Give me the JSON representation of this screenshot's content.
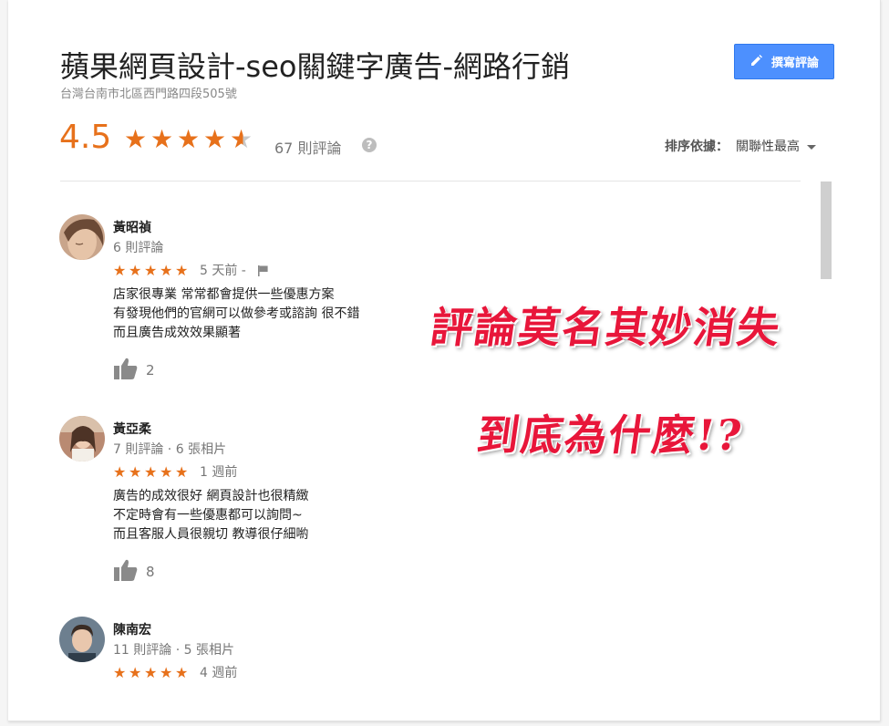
{
  "place": {
    "title": "蘋果網頁設計-seo關鍵字廣告-網路行銷",
    "address": "台灣台南市北區西門路四段505號"
  },
  "write_review": {
    "label": "撰寫評論",
    "icon": "pencil-icon"
  },
  "rating": {
    "value": "4.5",
    "score": 4.5,
    "count_text": "67 則評論",
    "help_symbol": "?"
  },
  "sort": {
    "label": "排序依據：",
    "value": "關聯性最高"
  },
  "reviews": [
    {
      "name": "黃昭禎",
      "meta": "6 則評論",
      "stars": 5,
      "date": "5 天前 -",
      "has_flag": true,
      "lines": [
        "店家很專業 常常都會提供一些優惠方案",
        "有發現他們的官網可以做參考或諮詢 很不錯",
        "而且廣告成效效果顯著"
      ],
      "likes": "2"
    },
    {
      "name": "黃亞柔",
      "meta": "7 則評論 · 6 張相片",
      "stars": 5,
      "date": "1 週前",
      "has_flag": false,
      "lines": [
        "廣告的成效很好 網頁設計也很精緻",
        "不定時會有一些優惠都可以詢問~",
        "而且客服人員很親切 教導很仔細喲"
      ],
      "likes": "8"
    },
    {
      "name": "陳南宏",
      "meta": "11 則評論 · 5 張相片",
      "stars": 5,
      "date": "4 週前",
      "has_flag": false,
      "lines": [],
      "likes": ""
    }
  ],
  "overlay": {
    "line1": "評論莫名其妙消失",
    "line2": "到底為什麼!?"
  },
  "colors": {
    "accent_orange": "#e7711b",
    "button_blue": "#4d90fe",
    "overlay_red": "#e8163a"
  }
}
